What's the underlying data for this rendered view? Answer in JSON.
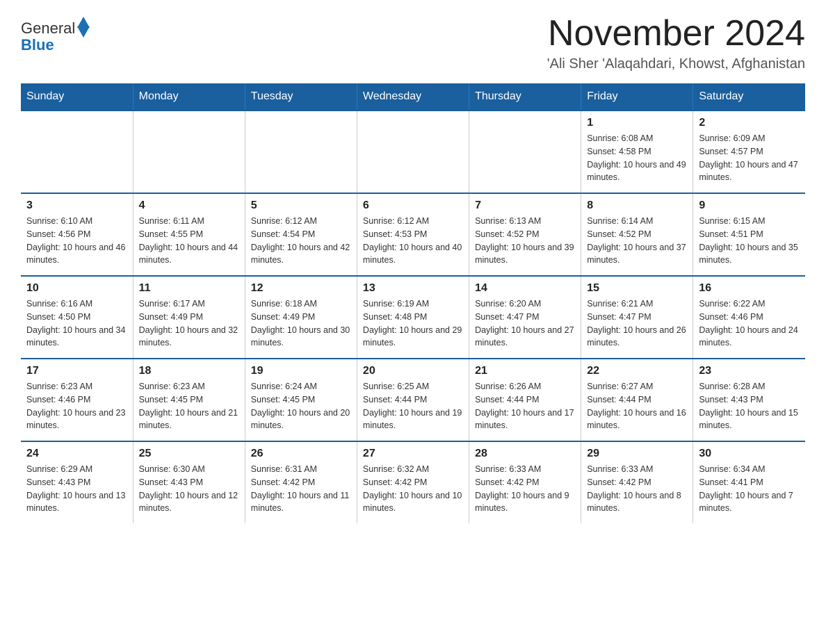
{
  "header": {
    "logo_general": "General",
    "logo_blue": "Blue",
    "month_title": "November 2024",
    "location": "'Ali Sher 'Alaqahdari, Khowst, Afghanistan"
  },
  "days_of_week": [
    "Sunday",
    "Monday",
    "Tuesday",
    "Wednesday",
    "Thursday",
    "Friday",
    "Saturday"
  ],
  "weeks": [
    [
      {
        "day": "",
        "info": ""
      },
      {
        "day": "",
        "info": ""
      },
      {
        "day": "",
        "info": ""
      },
      {
        "day": "",
        "info": ""
      },
      {
        "day": "",
        "info": ""
      },
      {
        "day": "1",
        "info": "Sunrise: 6:08 AM\nSunset: 4:58 PM\nDaylight: 10 hours and 49 minutes."
      },
      {
        "day": "2",
        "info": "Sunrise: 6:09 AM\nSunset: 4:57 PM\nDaylight: 10 hours and 47 minutes."
      }
    ],
    [
      {
        "day": "3",
        "info": "Sunrise: 6:10 AM\nSunset: 4:56 PM\nDaylight: 10 hours and 46 minutes."
      },
      {
        "day": "4",
        "info": "Sunrise: 6:11 AM\nSunset: 4:55 PM\nDaylight: 10 hours and 44 minutes."
      },
      {
        "day": "5",
        "info": "Sunrise: 6:12 AM\nSunset: 4:54 PM\nDaylight: 10 hours and 42 minutes."
      },
      {
        "day": "6",
        "info": "Sunrise: 6:12 AM\nSunset: 4:53 PM\nDaylight: 10 hours and 40 minutes."
      },
      {
        "day": "7",
        "info": "Sunrise: 6:13 AM\nSunset: 4:52 PM\nDaylight: 10 hours and 39 minutes."
      },
      {
        "day": "8",
        "info": "Sunrise: 6:14 AM\nSunset: 4:52 PM\nDaylight: 10 hours and 37 minutes."
      },
      {
        "day": "9",
        "info": "Sunrise: 6:15 AM\nSunset: 4:51 PM\nDaylight: 10 hours and 35 minutes."
      }
    ],
    [
      {
        "day": "10",
        "info": "Sunrise: 6:16 AM\nSunset: 4:50 PM\nDaylight: 10 hours and 34 minutes."
      },
      {
        "day": "11",
        "info": "Sunrise: 6:17 AM\nSunset: 4:49 PM\nDaylight: 10 hours and 32 minutes."
      },
      {
        "day": "12",
        "info": "Sunrise: 6:18 AM\nSunset: 4:49 PM\nDaylight: 10 hours and 30 minutes."
      },
      {
        "day": "13",
        "info": "Sunrise: 6:19 AM\nSunset: 4:48 PM\nDaylight: 10 hours and 29 minutes."
      },
      {
        "day": "14",
        "info": "Sunrise: 6:20 AM\nSunset: 4:47 PM\nDaylight: 10 hours and 27 minutes."
      },
      {
        "day": "15",
        "info": "Sunrise: 6:21 AM\nSunset: 4:47 PM\nDaylight: 10 hours and 26 minutes."
      },
      {
        "day": "16",
        "info": "Sunrise: 6:22 AM\nSunset: 4:46 PM\nDaylight: 10 hours and 24 minutes."
      }
    ],
    [
      {
        "day": "17",
        "info": "Sunrise: 6:23 AM\nSunset: 4:46 PM\nDaylight: 10 hours and 23 minutes."
      },
      {
        "day": "18",
        "info": "Sunrise: 6:23 AM\nSunset: 4:45 PM\nDaylight: 10 hours and 21 minutes."
      },
      {
        "day": "19",
        "info": "Sunrise: 6:24 AM\nSunset: 4:45 PM\nDaylight: 10 hours and 20 minutes."
      },
      {
        "day": "20",
        "info": "Sunrise: 6:25 AM\nSunset: 4:44 PM\nDaylight: 10 hours and 19 minutes."
      },
      {
        "day": "21",
        "info": "Sunrise: 6:26 AM\nSunset: 4:44 PM\nDaylight: 10 hours and 17 minutes."
      },
      {
        "day": "22",
        "info": "Sunrise: 6:27 AM\nSunset: 4:44 PM\nDaylight: 10 hours and 16 minutes."
      },
      {
        "day": "23",
        "info": "Sunrise: 6:28 AM\nSunset: 4:43 PM\nDaylight: 10 hours and 15 minutes."
      }
    ],
    [
      {
        "day": "24",
        "info": "Sunrise: 6:29 AM\nSunset: 4:43 PM\nDaylight: 10 hours and 13 minutes."
      },
      {
        "day": "25",
        "info": "Sunrise: 6:30 AM\nSunset: 4:43 PM\nDaylight: 10 hours and 12 minutes."
      },
      {
        "day": "26",
        "info": "Sunrise: 6:31 AM\nSunset: 4:42 PM\nDaylight: 10 hours and 11 minutes."
      },
      {
        "day": "27",
        "info": "Sunrise: 6:32 AM\nSunset: 4:42 PM\nDaylight: 10 hours and 10 minutes."
      },
      {
        "day": "28",
        "info": "Sunrise: 6:33 AM\nSunset: 4:42 PM\nDaylight: 10 hours and 9 minutes."
      },
      {
        "day": "29",
        "info": "Sunrise: 6:33 AM\nSunset: 4:42 PM\nDaylight: 10 hours and 8 minutes."
      },
      {
        "day": "30",
        "info": "Sunrise: 6:34 AM\nSunset: 4:41 PM\nDaylight: 10 hours and 7 minutes."
      }
    ]
  ]
}
